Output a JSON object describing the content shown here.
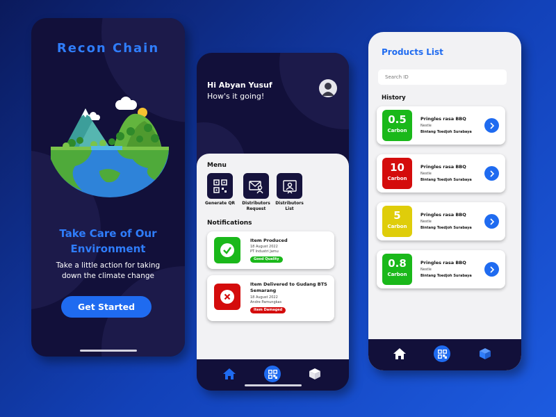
{
  "colors": {
    "accent": "#1f6bf0",
    "dark": "#12103a",
    "good": "#1ab81a",
    "bad": "#d40c0c",
    "warn": "#dfcd0a"
  },
  "welcome": {
    "app_title": "Recon Chain",
    "tagline": "Take Care of Our Environment",
    "subline": "Take a little action for taking down the climate change",
    "cta_label": "Get Started",
    "illustration": "earth-globe-illustration"
  },
  "dashboard": {
    "greeting": "Hi Abyan Yusuf",
    "greeting_sub": "How's it going!",
    "avatar_icon": "user-avatar-icon",
    "menu_title": "Menu",
    "menu": [
      {
        "label": "Generate QR",
        "icon": "qr-code-icon"
      },
      {
        "label": "Distributors Request",
        "icon": "user-mail-icon"
      },
      {
        "label": "Distributors List",
        "icon": "user-board-icon"
      }
    ],
    "notifications_title": "Notifications",
    "notifications": [
      {
        "title": "Item Produced",
        "date": "18 August 2022",
        "party": "PT Industri Jamu",
        "status": "Good Quality",
        "icon": "check-icon"
      },
      {
        "title": "Item Delivered to Gudang BTS Semarang",
        "date": "18 August 2022",
        "party": "Andre Pamungkas",
        "status": "Item Damaged",
        "icon": "close-icon"
      }
    ],
    "nav": [
      "home-icon",
      "qr-scan-icon",
      "box-icon"
    ]
  },
  "products": {
    "title": "Products List",
    "search_placeholder": "Search ID",
    "history_title": "History",
    "items": [
      {
        "score": "0.5",
        "unit": "Carbon",
        "name": "Pringles rasa BBQ",
        "brand": "Nestle",
        "distributor": "Bintang Toedjoh Surabaya",
        "level": "good"
      },
      {
        "score": "10",
        "unit": "Carbon",
        "name": "Pringles rasa BBQ",
        "brand": "Nestle",
        "distributor": "Bintang Toedjoh Surabaya",
        "level": "bad"
      },
      {
        "score": "5",
        "unit": "Carbon",
        "name": "Pringles rasa BBQ",
        "brand": "Nestle",
        "distributor": "Bintang Toedjoh Surabaya",
        "level": "warn"
      },
      {
        "score": "0.8",
        "unit": "Carbon",
        "name": "Pringles rasa BBQ",
        "brand": "Nestle",
        "distributor": "Bintang Toedjoh Surabaya",
        "level": "good"
      }
    ],
    "nav": [
      "home-icon",
      "qr-scan-icon",
      "box-icon"
    ]
  }
}
